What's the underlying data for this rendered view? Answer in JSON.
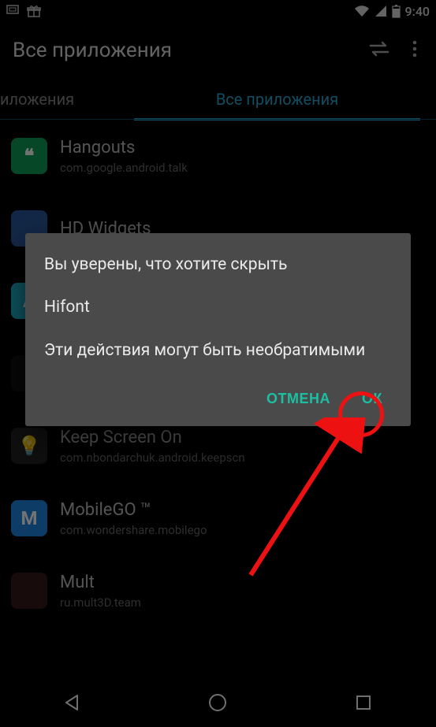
{
  "status": {
    "time": "9:40"
  },
  "header": {
    "title": "Все приложения"
  },
  "tabs": {
    "left_partial": "иложения",
    "active": "Все приложения"
  },
  "apps": [
    {
      "name": "Hangouts",
      "pkg": "com.google.android.talk",
      "icon_bg": "#0d9d58",
      "icon_label": "❝"
    },
    {
      "name": "HD Widgets",
      "pkg": "",
      "icon_bg": "#2a5aa0",
      "icon_label": ""
    },
    {
      "name": "",
      "pkg": "",
      "icon_bg": "#1fbad6",
      "icon_label": "A"
    },
    {
      "name": "",
      "pkg": "",
      "icon_bg": "#111",
      "icon_label": ""
    },
    {
      "name": "Keep Screen On",
      "pkg": "com.nbondarchuk.android.keepscn",
      "icon_bg": "#222",
      "icon_label": "💡"
    },
    {
      "name": "MobileGO ™",
      "pkg": "com.wondershare.mobilego",
      "icon_bg": "#1e88e5",
      "icon_label": "M"
    },
    {
      "name": "Mult",
      "pkg": "ru.mult3D.team",
      "icon_bg": "#331a1a",
      "icon_label": ""
    }
  ],
  "dialog": {
    "line1": "Вы уверены, что хотите скрыть",
    "line2": "Hifont",
    "line3": "Эти действия могут быть необратимыми",
    "cancel": "ОТМЕНА",
    "ok": "ОК"
  }
}
